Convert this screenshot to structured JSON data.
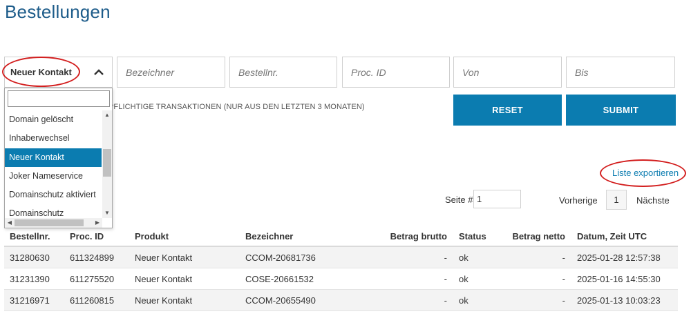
{
  "page": {
    "title": "Bestellungen"
  },
  "filters": {
    "type_selected": "Neuer Kontakt",
    "placeholders": {
      "bezeichner": "Bezeichner",
      "bestellnr": "Bestellnr.",
      "proc_id": "Proc. ID",
      "von": "Von",
      "bis": "Bis"
    },
    "note": "PFLICHTIGE TRANSAKTIONEN (NUR AUS DEN LETZTEN 3 MONATEN)",
    "reset_label": "RESET",
    "submit_label": "SUBMIT"
  },
  "dropdown": {
    "search_value": "",
    "items": [
      {
        "label": "Domain gelöscht",
        "selected": false
      },
      {
        "label": "Inhaberwechsel",
        "selected": false
      },
      {
        "label": "Neuer Kontakt",
        "selected": true
      },
      {
        "label": "Joker Nameservice",
        "selected": false
      },
      {
        "label": "Domainschutz aktiviert",
        "selected": false
      },
      {
        "label": "Domainschutz",
        "selected": false
      }
    ]
  },
  "export": {
    "label": "Liste exportieren"
  },
  "pagination": {
    "page_label": "Seite #",
    "page_value": "1",
    "prev_label": "Vorherige",
    "current": "1",
    "next_label": "Nächste"
  },
  "table": {
    "headers": {
      "bestellnr": "Bestellnr.",
      "proc_id": "Proc. ID",
      "produkt": "Produkt",
      "bezeichner": "Bezeichner",
      "betrag_brutto": "Betrag brutto",
      "status": "Status",
      "betrag_netto": "Betrag netto",
      "datum": "Datum, Zeit UTC"
    },
    "rows": [
      {
        "bestellnr": "31280630",
        "proc_id": "611324899",
        "produkt": "Neuer Kontakt",
        "bezeichner": "CCOM-20681736",
        "betrag_brutto": "-",
        "status": "ok",
        "betrag_netto": "-",
        "datum": "2025-01-28 12:57:38"
      },
      {
        "bestellnr": "31231390",
        "proc_id": "611275520",
        "produkt": "Neuer Kontakt",
        "bezeichner": "COSE-20661532",
        "betrag_brutto": "-",
        "status": "ok",
        "betrag_netto": "-",
        "datum": "2025-01-16 14:55:30"
      },
      {
        "bestellnr": "31216971",
        "proc_id": "611260815",
        "produkt": "Neuer Kontakt",
        "bezeichner": "CCOM-20655490",
        "betrag_brutto": "-",
        "status": "ok",
        "betrag_netto": "-",
        "datum": "2025-01-13 10:03:23"
      }
    ]
  },
  "colors": {
    "accent": "#0b7cb0",
    "title": "#1d5c8a",
    "annotation": "#d31f1f"
  }
}
